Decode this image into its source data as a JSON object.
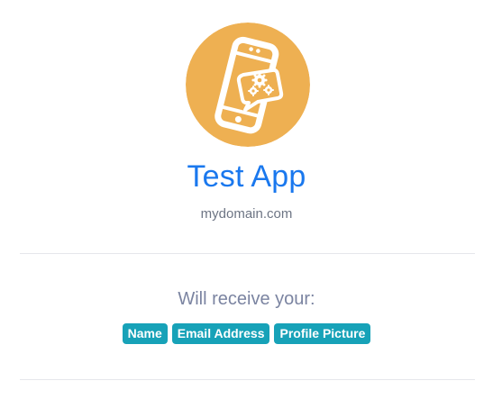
{
  "app": {
    "name": "Test App",
    "domain": "mydomain.com",
    "logo_icon": "phone-chat-gears-icon",
    "logo_bg_color": "#eeb052",
    "name_color": "#1a78ee"
  },
  "consent": {
    "heading": "Will receive your:",
    "scopes": [
      "Name",
      "Email Address",
      "Profile Picture"
    ],
    "badge_color": "#17a2b8"
  }
}
